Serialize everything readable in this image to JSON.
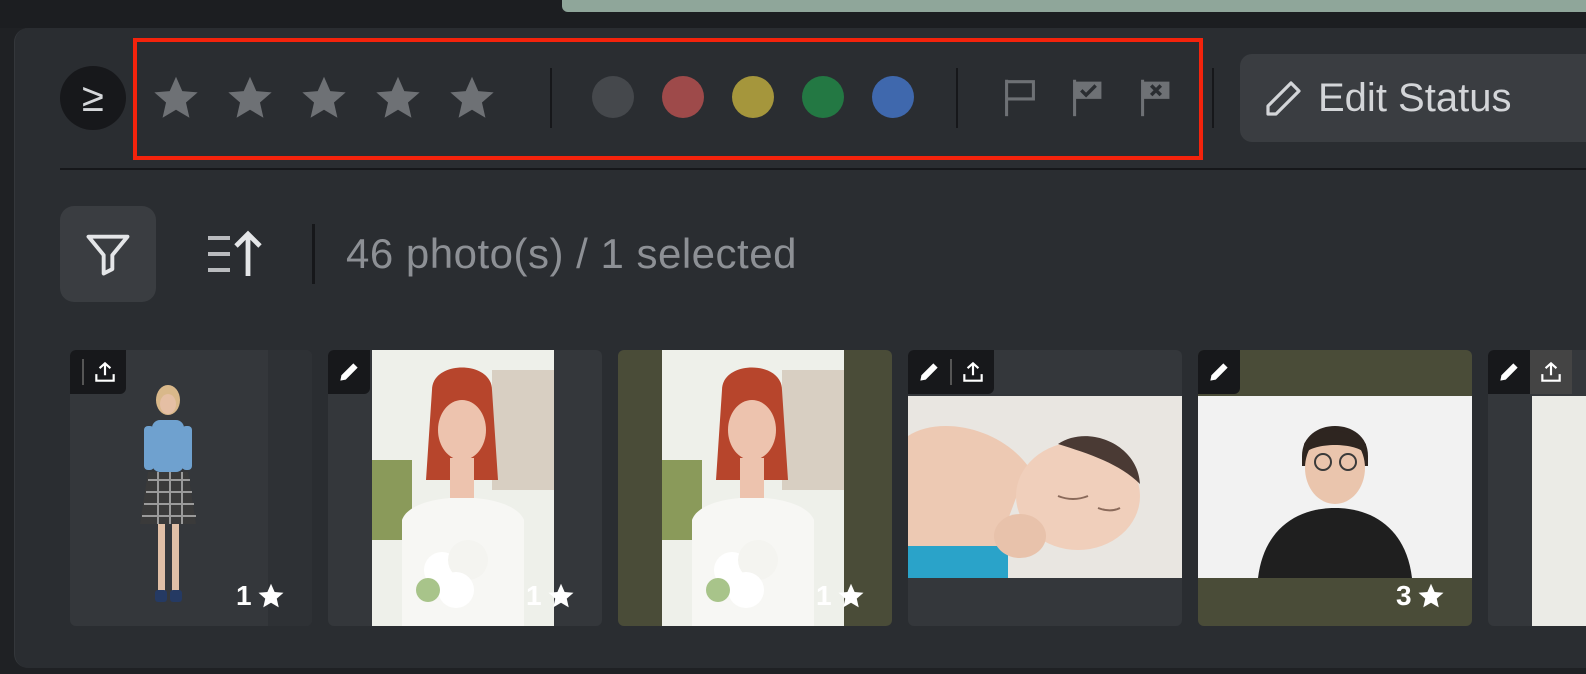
{
  "toolbar": {
    "toggle_symbol": "≥",
    "stars": [
      "star-1",
      "star-2",
      "star-3",
      "star-4",
      "star-5"
    ],
    "color_labels": [
      {
        "name": "none",
        "hex": "#45484c"
      },
      {
        "name": "red",
        "hex": "#9e4a4a"
      },
      {
        "name": "yellow",
        "hex": "#a5963c"
      },
      {
        "name": "green",
        "hex": "#237843"
      },
      {
        "name": "blue",
        "hex": "#3f68ad"
      }
    ],
    "flags": [
      "flag-unflagged-icon",
      "flag-pick-icon",
      "flag-reject-icon"
    ],
    "edit_status_label": "Edit Status"
  },
  "filterbar": {
    "count_text": "46 photo(s) / 1 selected"
  },
  "thumbnails": [
    {
      "rating": "1"
    },
    {
      "rating": "1"
    },
    {
      "rating": "1"
    },
    {
      "rating": ""
    },
    {
      "rating": "3"
    },
    {
      "rating": ""
    }
  ],
  "colors": {
    "highlight": "#f4230c",
    "panel": "#2a2d31",
    "olive_selected": "#4a4c38"
  }
}
